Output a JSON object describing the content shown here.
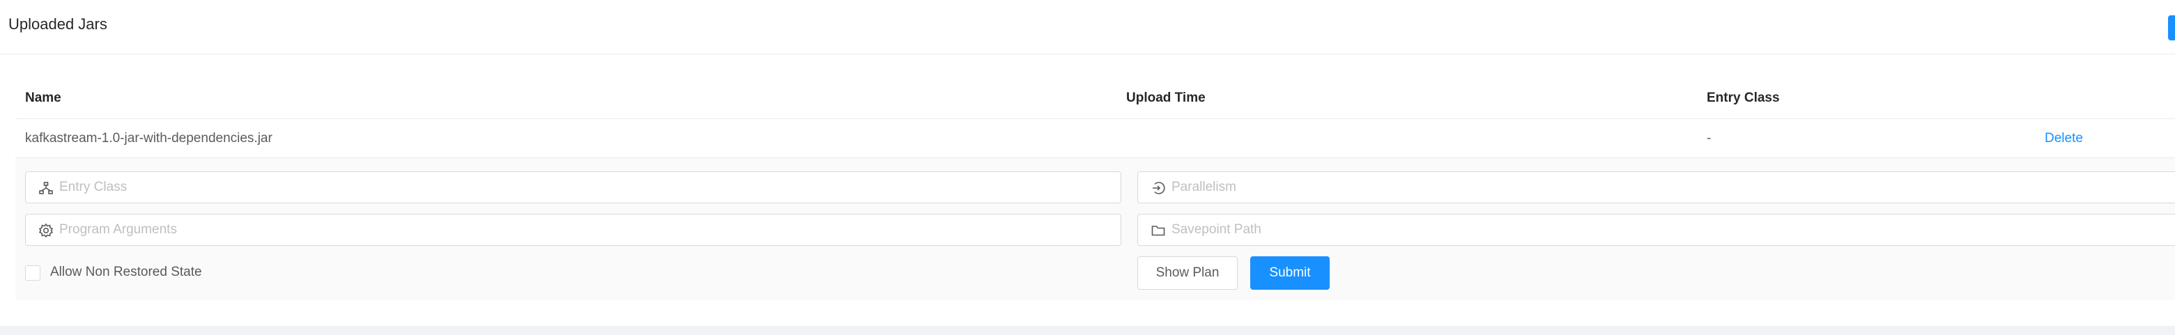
{
  "card": {
    "title": "Uploaded Jars"
  },
  "table": {
    "columns": [
      "Name",
      "Upload Time",
      "Entry Class",
      ""
    ],
    "rows": [
      {
        "name": "kafkastream-1.0-jar-with-dependencies.jar",
        "upload_time": "",
        "entry_class": "-",
        "action": "Delete"
      }
    ]
  },
  "form": {
    "entry_class": {
      "placeholder": "Entry Class",
      "icon": "tree-icon"
    },
    "parallelism": {
      "placeholder": "Parallelism",
      "icon": "login-icon"
    },
    "program_arguments": {
      "placeholder": "Program Arguments",
      "icon": "gear-icon"
    },
    "savepoint_path": {
      "placeholder": "Savepoint Path",
      "icon": "folder-icon"
    },
    "allow_non_restored": {
      "label": "Allow Non Restored State",
      "checked": false
    },
    "show_plan_label": "Show Plan",
    "submit_label": "Submit"
  },
  "colors": {
    "primary": "#1890ff",
    "border": "#d9d9d9",
    "placeholder": "#bfbfbf",
    "expanded_bg": "#fafafa"
  }
}
